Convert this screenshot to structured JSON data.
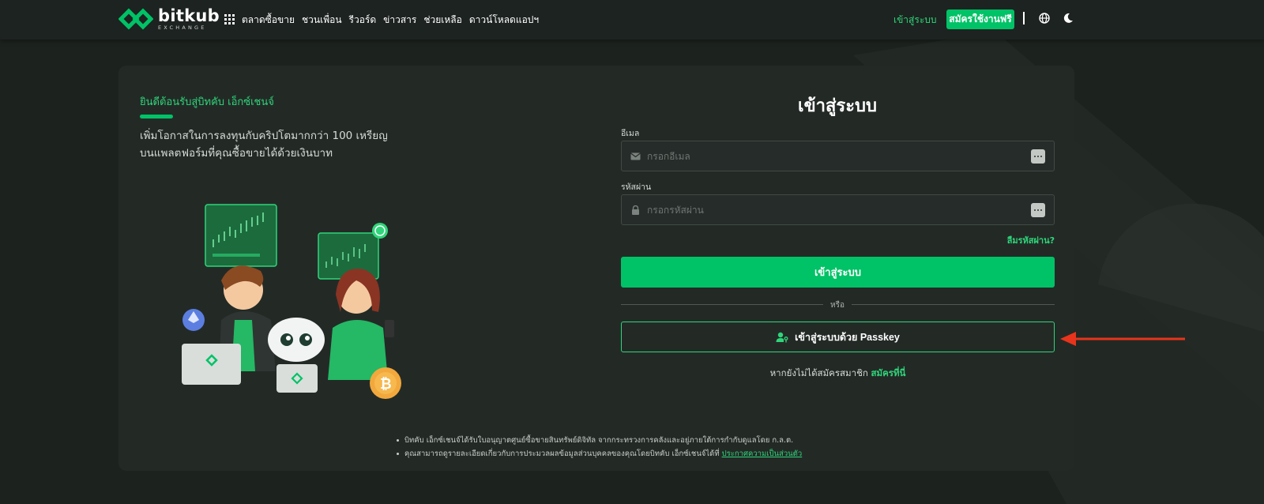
{
  "nav": {
    "logo_main": "bitkub",
    "logo_sub": "EXCHANGE",
    "links": [
      "ตลาดซื้อขาย",
      "ชวนเพื่อน",
      "รีวอร์ด",
      "ข่าวสาร",
      "ช่วยเหลือ",
      "ดาวน์โหลดแอปฯ"
    ],
    "login": "เข้าสู่ระบบ",
    "signup": "สมัครใช้งานฟรี"
  },
  "intro": {
    "welcome": "ยินดีต้อนรับสู่บิทคับ เอ็กซ์เชนจ์",
    "line1": "เพิ่มโอกาสในการลงทุนกับคริปโตมากกว่า 100 เหรียญ",
    "line2": "บนแพลตฟอร์มที่คุณซื้อขายได้ด้วยเงินบาท"
  },
  "form": {
    "title": "เข้าสู่ระบบ",
    "email_label": "อีเมล",
    "email_placeholder": "กรอกอีเมล",
    "password_label": "รหัสผ่าน",
    "password_placeholder": "กรอกรหัสผ่าน",
    "forgot": "ลืมรหัสผ่าน?",
    "submit": "เข้าสู่ระบบ",
    "or": "หรือ",
    "passkey": "เข้าสู่ระบบด้วย Passkey",
    "no_account": "หากยังไม่ได้สมัครสมาชิก",
    "register": "สมัครที่นี่"
  },
  "footer": {
    "note1": "บิทคับ เอ็กซ์เชนจ์ได้รับใบอนุญาตศูนย์ซื้อขายสินทรัพย์ดิจิทัล จากกระทรวงการคลังและอยู่ภายใต้การกำกับดูแลโดย ก.ล.ต.",
    "note2_prefix": "คุณสามารถดูรายละเอียดเกี่ยวกับการประมวลผลข้อมูลส่วนบุคคลของคุณโดยบิทคับ เอ็กซ์เชนจ์ได้ที่",
    "note2_link": "ประกาศความเป็นส่วนตัว"
  },
  "colors": {
    "accent": "#00c266",
    "accent_text": "#2fd57a",
    "background": "#1c221e",
    "card": "#232a26",
    "annotation_arrow": "#e8341c"
  },
  "icons": [
    "grid-icon",
    "globe-icon",
    "moon-icon",
    "envelope-icon",
    "lock-icon",
    "user-key-icon",
    "password-manager-icon"
  ]
}
